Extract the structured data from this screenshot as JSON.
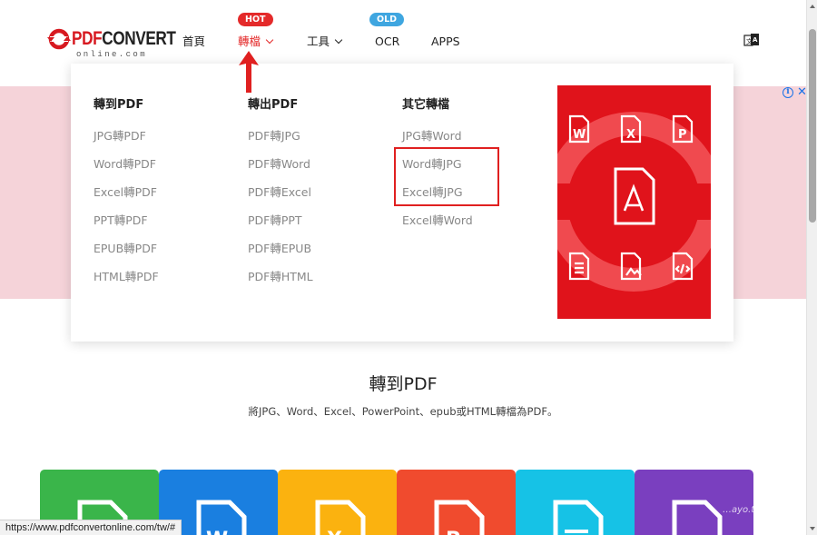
{
  "logo": {
    "brand_red": "PDF",
    "brand_dark": "CONVERT",
    "sub": "online.com"
  },
  "nav": {
    "home": "首頁",
    "convert": "轉檔",
    "tools": "工具",
    "ocr": "OCR",
    "apps": "APPS",
    "hot_badge": "HOT",
    "old_badge": "OLD"
  },
  "menu": {
    "col1": {
      "title": "轉到PDF",
      "items": [
        "JPG轉PDF",
        "Word轉PDF",
        "Excel轉PDF",
        "PPT轉PDF",
        "EPUB轉PDF",
        "HTML轉PDF"
      ]
    },
    "col2": {
      "title": "轉出PDF",
      "items": [
        "PDF轉JPG",
        "PDF轉Word",
        "PDF轉Excel",
        "PDF轉PPT",
        "PDF轉EPUB",
        "PDF轉HTML"
      ]
    },
    "col3": {
      "title": "其它轉檔",
      "items": [
        "JPG轉Word",
        "Word轉JPG",
        "Excel轉JPG",
        "Excel轉Word"
      ]
    }
  },
  "promo_icons": {
    "word": "W",
    "excel": "X",
    "ppt": "P"
  },
  "section": {
    "title": "轉到PDF",
    "desc": "將JPG、Word、Excel、PowerPoint、epub或HTML轉檔為PDF。"
  },
  "card_letters": {
    "word": "W",
    "excel": "X",
    "ppt": "P"
  },
  "status_url": "https://www.pdfconvertonline.com/tw/#",
  "watermark": "…ayo.tw/",
  "colors": {
    "accent_red": "#e42a2a",
    "badge_blue": "#3fa6e0",
    "promo_red": "#e0131b",
    "pink_strip": "#f5d3d9",
    "card_green": "#3ab54a",
    "card_blue": "#1a7fe0",
    "card_yellow": "#fbb20f",
    "card_orange": "#f04b2e",
    "card_cyan": "#16c2e6",
    "card_purple": "#7a3fbf"
  }
}
